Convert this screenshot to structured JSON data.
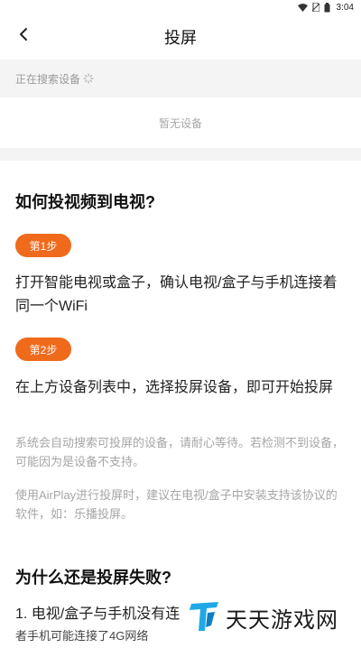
{
  "status_bar": {
    "time": "3:04"
  },
  "header": {
    "title": "投屏"
  },
  "search": {
    "status": "正在搜索设备"
  },
  "devices": {
    "empty_text": "暂无设备"
  },
  "guide": {
    "heading": "如何投视频到电视?",
    "steps": [
      {
        "badge": "第1步",
        "text": "打开智能电视或盒子，确认电视/盒子与手机连接着同一个WiFi"
      },
      {
        "badge": "第2步",
        "text": "在上方设备列表中，选择投屏设备，即可开始投屏"
      }
    ],
    "notes": [
      "系统会自动搜索可投屏的设备，请耐心等待。若检测不到设备，可能因为是设备不支持。",
      "使用AirPlay进行投屏时，建议在电视/盒子中安装支持该协议的软件，如：乐播投屏。"
    ]
  },
  "failure": {
    "heading": "为什么还是投屏失败?",
    "items": [
      "1. 电视/盒子与手机没有连",
      "者手机可能连接了4G网络"
    ]
  },
  "watermark": {
    "brand": "天天游戏网"
  }
}
